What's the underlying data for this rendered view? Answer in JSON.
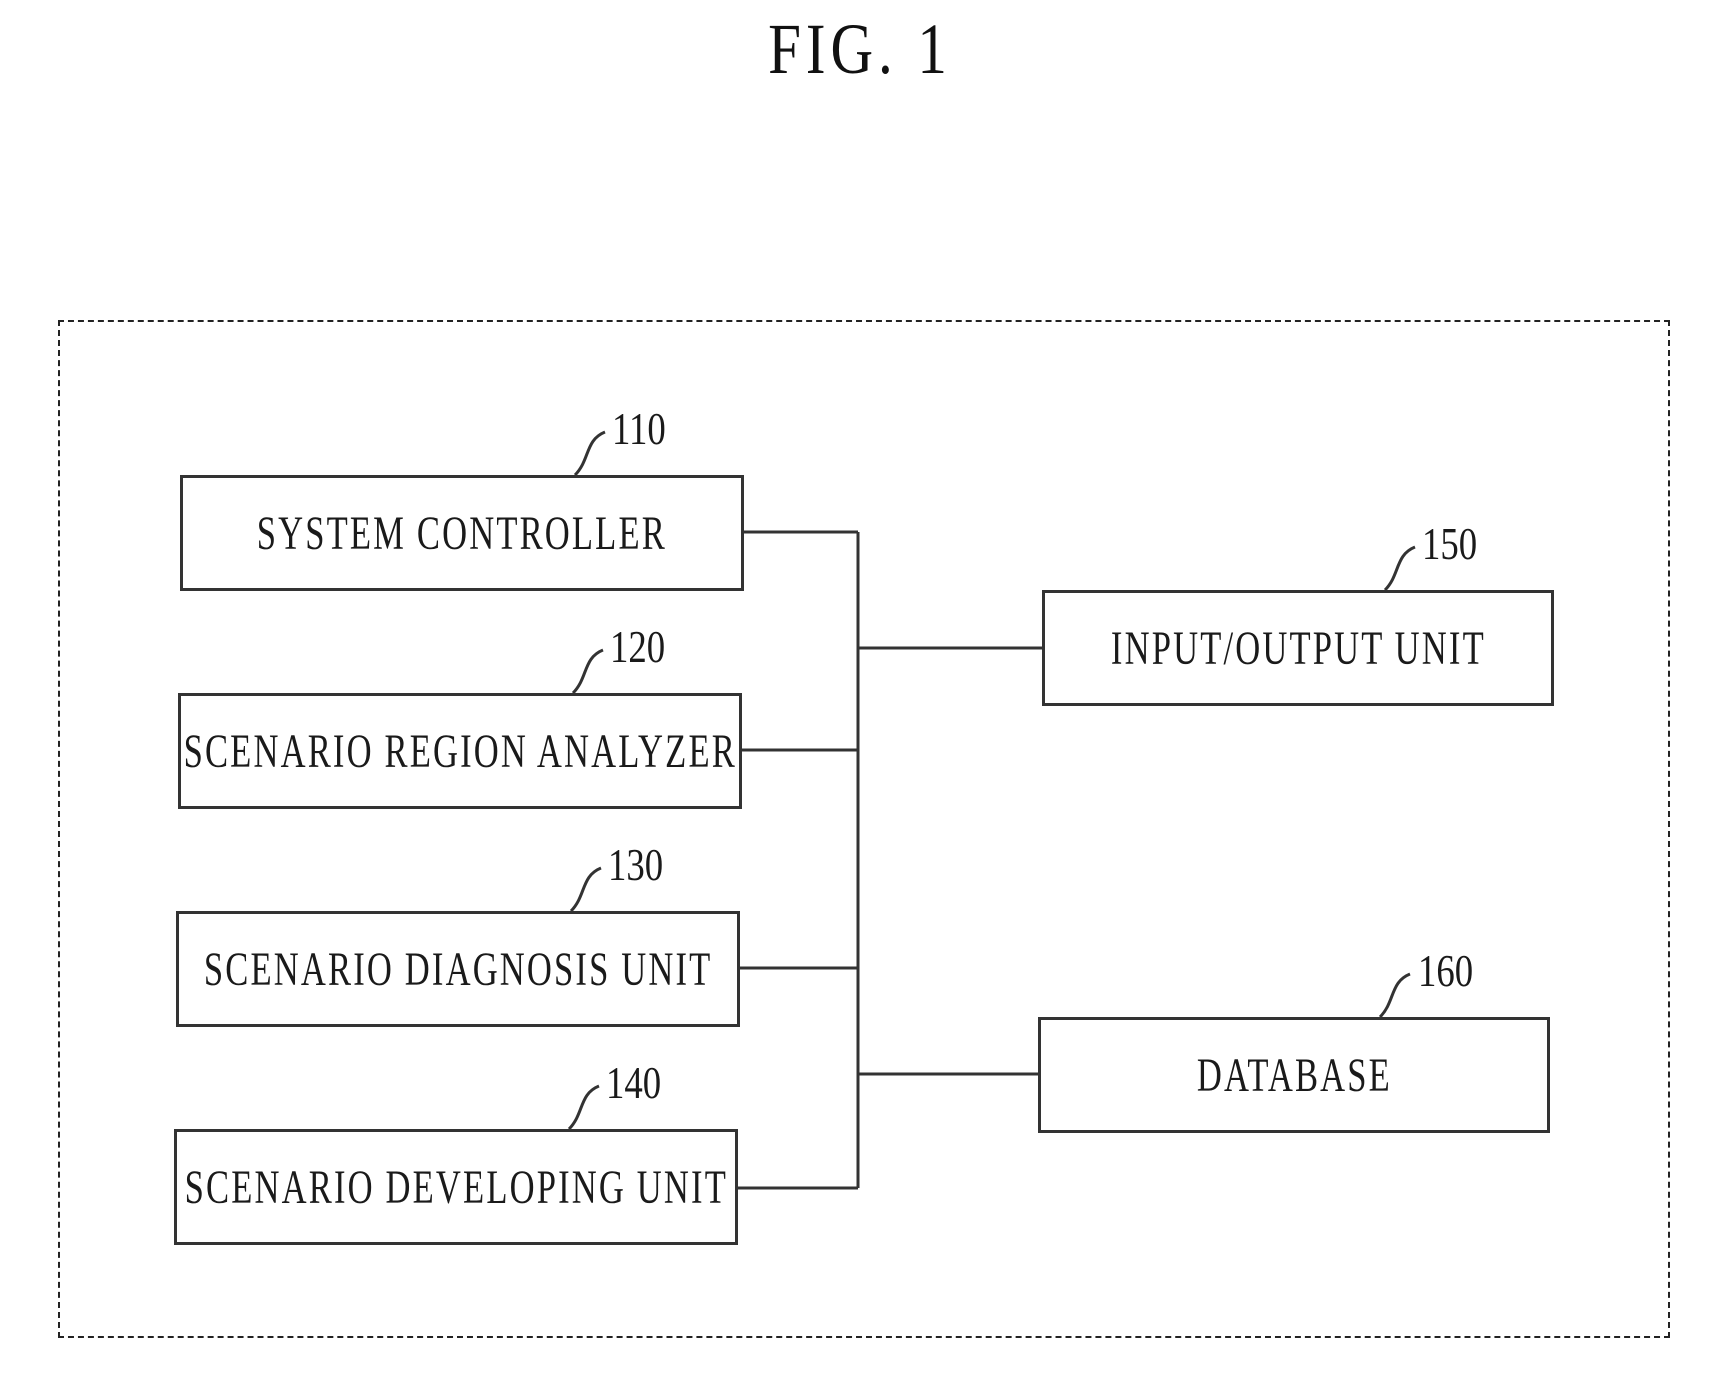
{
  "figure": {
    "title": "FIG. 1"
  },
  "blocks": [
    {
      "id": "110",
      "label": "SYSTEM CONTROLLER"
    },
    {
      "id": "120",
      "label": "SCENARIO REGION ANALYZER"
    },
    {
      "id": "130",
      "label": "SCENARIO DIAGNOSIS UNIT"
    },
    {
      "id": "140",
      "label": "SCENARIO DEVELOPING UNIT"
    },
    {
      "id": "150",
      "label": "INPUT/OUTPUT UNIT"
    },
    {
      "id": "160",
      "label": "DATABASE"
    }
  ],
  "connections": [
    {
      "from": "110",
      "to": "bus"
    },
    {
      "from": "120",
      "to": "bus"
    },
    {
      "from": "130",
      "to": "bus"
    },
    {
      "from": "140",
      "to": "bus"
    },
    {
      "from": "bus",
      "to": "150"
    },
    {
      "from": "bus",
      "to": "160"
    }
  ],
  "enclosure": {
    "style": "dashed"
  }
}
